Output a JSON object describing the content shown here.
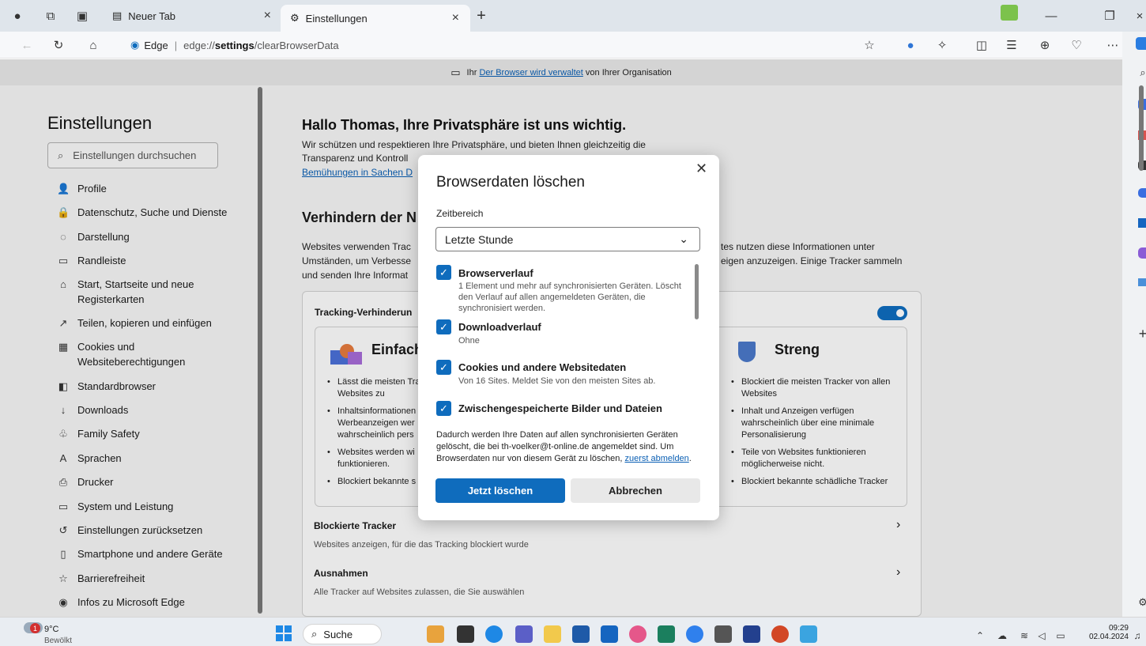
{
  "tabs": {
    "tab1_label": "Neuer Tab",
    "tab2_label": "Einstellungen"
  },
  "address": {
    "brand": "Edge",
    "separator": "|",
    "url_prefix": "edge://",
    "url_bold": "settings",
    "url_rest": "/clearBrowserData"
  },
  "banner": {
    "pre": "Ihr",
    "link": "Der Browser wird verwaltet",
    "post": "von Ihrer Organisation"
  },
  "sidebar": {
    "title": "Einstellungen",
    "search_placeholder": "Einstellungen durchsuchen",
    "items": [
      {
        "label": "Profile",
        "icon": "👤"
      },
      {
        "label": "Datenschutz, Suche und Dienste",
        "icon": "🔒"
      },
      {
        "label": "Darstellung",
        "icon": "◌"
      },
      {
        "label": "Randleiste",
        "icon": "▭"
      },
      {
        "label": "Start, Startseite und neue Registerkarten",
        "icon": "⌂"
      },
      {
        "label": "Teilen, kopieren und einfügen",
        "icon": "↗"
      },
      {
        "label": "Cookies und Websiteberechtigungen",
        "icon": "▦"
      },
      {
        "label": "Standardbrowser",
        "icon": "◧"
      },
      {
        "label": "Downloads",
        "icon": "↓"
      },
      {
        "label": "Family Safety",
        "icon": "♧"
      },
      {
        "label": "Sprachen",
        "icon": "A"
      },
      {
        "label": "Drucker",
        "icon": "⎙"
      },
      {
        "label": "System und Leistung",
        "icon": "▭"
      },
      {
        "label": "Einstellungen zurücksetzen",
        "icon": "↺"
      },
      {
        "label": "Smartphone und andere Geräte",
        "icon": "▯"
      },
      {
        "label": "Barrierefreiheit",
        "icon": "☆"
      },
      {
        "label": "Infos zu Microsoft Edge",
        "icon": "◉"
      }
    ]
  },
  "content": {
    "hello": "Hallo Thomas, Ihre Privatsphäre ist uns wichtig.",
    "intro1": "Wir schützen und respektieren Ihre Privatsphäre, und bieten Ihnen gleichzeitig die",
    "intro2": "Transparenz und Kontroll",
    "intro_link": "Bemühungen in Sachen D",
    "verhindern": "Verhindern der N",
    "p1a": "Websites verwenden Trac",
    "p1b": "tes nutzen diese Informationen unter",
    "p2a": "Umständen, um Verbesse",
    "p2b": "eigen anzuzeigen. Einige Tracker sammeln",
    "p3a": "und senden Ihre Informat",
    "tracking": "Tracking-Verhinderun",
    "einfach": "Einfach",
    "streng": "Streng",
    "left_bullets": [
      "Lässt die meisten Tra",
      "Websites zu",
      "Inhaltsinformationen",
      "Werbeanzeigen wer",
      "wahrscheinlich pers",
      "Websites werden wi",
      "funktionieren.",
      "Blockiert bekannte s"
    ],
    "right_bullets": [
      "Blockiert die meisten Tracker von allen",
      "Websites",
      "Inhalt und Anzeigen verfügen",
      "wahrscheinlich über eine minimale",
      "Personalisierung",
      "Teile von Websites funktionieren",
      "möglicherweise nicht.",
      "Blockiert bekannte schädliche Tracker"
    ],
    "blocked_title": "Blockierte Tracker",
    "blocked_desc": "Websites anzeigen, für die das Tracking blockiert wurde",
    "exceptions_title": "Ausnahmen",
    "exceptions_desc": "Alle Tracker auf Websites zulassen, die Sie auswählen"
  },
  "dialog": {
    "title": "Browserdaten löschen",
    "range_label": "Zeitbereich",
    "range_value": "Letzte Stunde",
    "items": [
      {
        "label": "Browserverlauf",
        "desc1": "1 Element und mehr auf synchronisierten Geräten. Löscht",
        "desc2": "den Verlauf auf allen angemeldeten Geräten, die",
        "desc3": "synchronisiert werden."
      },
      {
        "label": "Downloadverlauf",
        "desc1": "Ohne"
      },
      {
        "label": "Cookies und andere Websitedaten",
        "desc1": "Von 16 Sites. Meldet Sie von den meisten Sites ab."
      },
      {
        "label": "Zwischengespeicherte Bilder und Dateien"
      }
    ],
    "note1": "Dadurch werden Ihre Daten auf allen synchronisierten Geräten",
    "note2": "gelöscht, die bei th-voelker@t-online.de angemeldet sind. Um",
    "note3": "Browserdaten nur von diesem Gerät zu löschen,",
    "note_link": "zuerst abmelden",
    "delete_label": "Jetzt löschen",
    "cancel_label": "Abbrechen"
  },
  "taskbar": {
    "temp": "9°C",
    "weather": "Bewölkt",
    "weather_badge": "1",
    "search": "Suche",
    "time": "09:29",
    "date": "02.04.2024"
  }
}
